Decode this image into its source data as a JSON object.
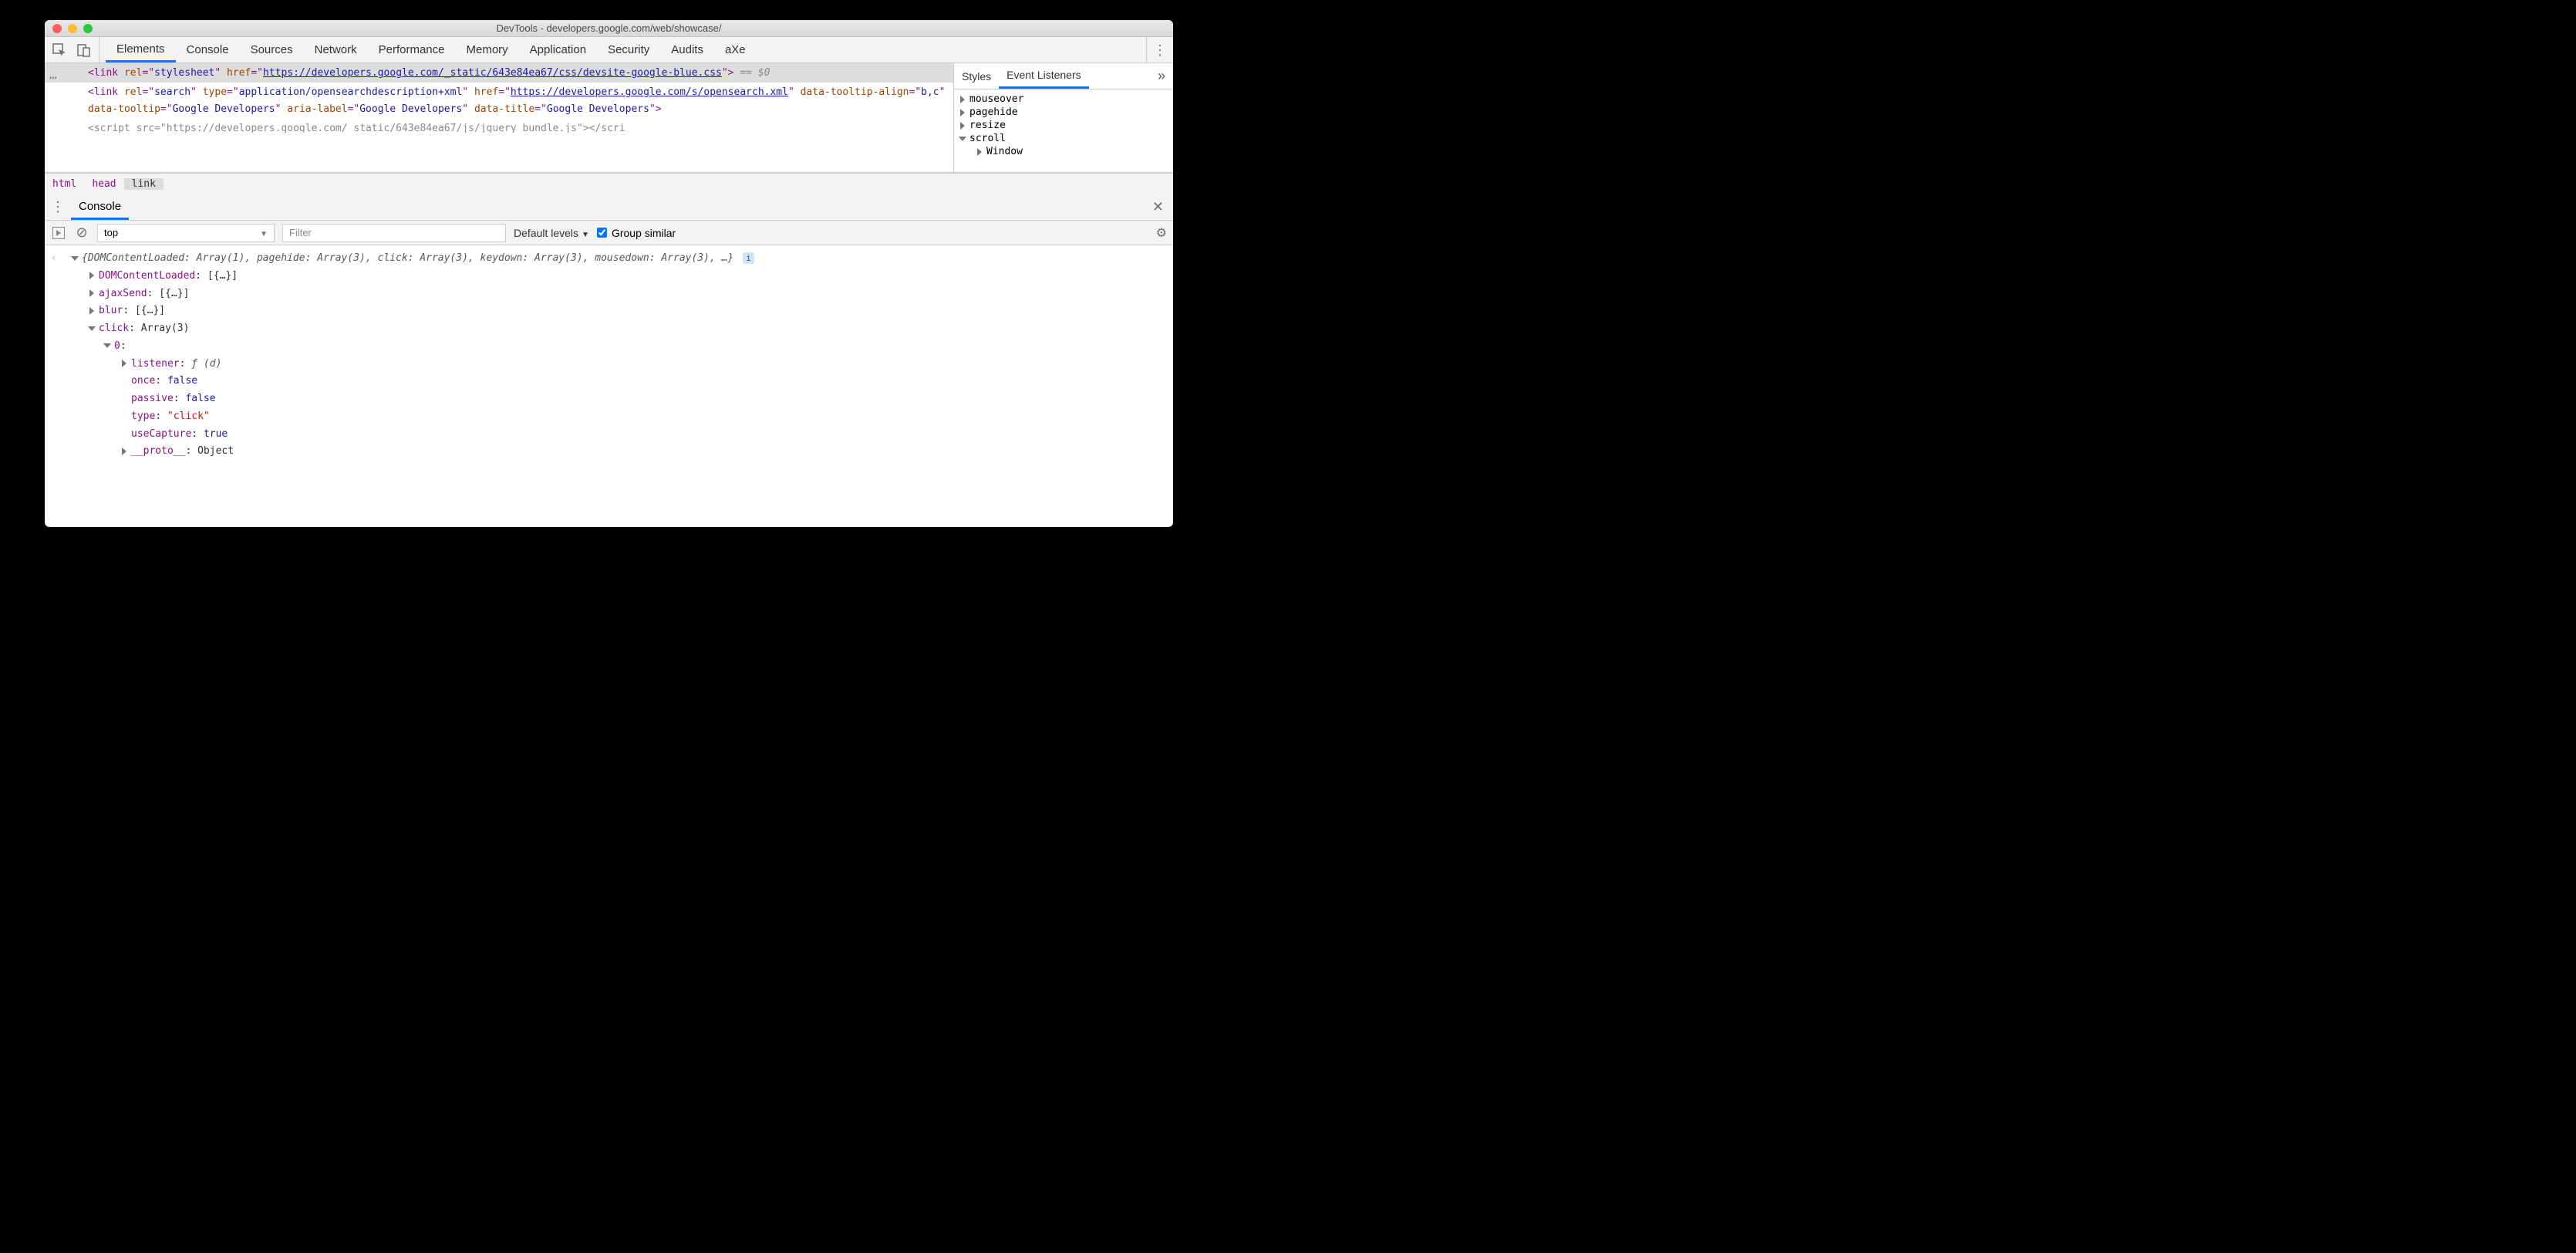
{
  "window": {
    "title": "DevTools - developers.google.com/web/showcase/"
  },
  "tabs": [
    "Elements",
    "Console",
    "Sources",
    "Network",
    "Performance",
    "Memory",
    "Application",
    "Security",
    "Audits",
    "aXe"
  ],
  "activeTab": "Elements",
  "dom": {
    "row1": {
      "tag": "link",
      "rel": "stylesheet",
      "href": "https://developers.google.com/_static/643e84ea67/css/devsite-google-blue.css",
      "selected_marker": "== $0"
    },
    "row2": {
      "tag": "link",
      "rel": "search",
      "type": "application/opensearchdescription+xml",
      "href": "https://developers.google.com/s/opensearch.xml",
      "tooltip_align": "b,c",
      "tooltip": "Google Developers",
      "aria_label": "Google Developers",
      "data_title": "Google Developers"
    },
    "row3_partial": "<script src=\"https://developers.google.com/_static/643e84ea67/js/jquery_bundle.js\"></scri"
  },
  "breadcrumb": [
    "html",
    "head",
    "link"
  ],
  "sidebar": {
    "tabs": [
      "Styles",
      "Event Listeners"
    ],
    "activeTab": "Event Listeners",
    "listeners": [
      {
        "name": "mouseover",
        "open": false
      },
      {
        "name": "pagehide",
        "open": false
      },
      {
        "name": "resize",
        "open": false
      },
      {
        "name": "scroll",
        "open": true,
        "children": [
          "Window"
        ]
      }
    ]
  },
  "consoleDrawer": {
    "tab": "Console",
    "context": "top",
    "filterPlaceholder": "Filter",
    "levels": "Default levels",
    "groupSimilar": "Group similar"
  },
  "consoleOutput": {
    "summary": "{DOMContentLoaded: Array(1), pagehide: Array(3), click: Array(3), keydown: Array(3), mousedown: Array(3), …}",
    "lines": [
      {
        "key": "DOMContentLoaded",
        "val": "[{…}]",
        "open": false,
        "lvl": 1
      },
      {
        "key": "ajaxSend",
        "val": "[{…}]",
        "open": false,
        "lvl": 1
      },
      {
        "key": "blur",
        "val": "[{…}]",
        "open": false,
        "lvl": 1
      },
      {
        "key": "click",
        "val": "Array(3)",
        "open": true,
        "lvl": 1
      },
      {
        "key": "0",
        "val": "",
        "open": true,
        "lvl": 2
      },
      {
        "key": "listener",
        "val": "ƒ (d)",
        "open": false,
        "lvl": 3,
        "fn": true
      },
      {
        "key": "once",
        "val": "false",
        "lvl": 3,
        "bool": true
      },
      {
        "key": "passive",
        "val": "false",
        "lvl": 3,
        "bool": true
      },
      {
        "key": "type",
        "val": "\"click\"",
        "lvl": 3,
        "str": true
      },
      {
        "key": "useCapture",
        "val": "true",
        "lvl": 3,
        "bool": true
      },
      {
        "key": "__proto__",
        "val": "Object",
        "open": false,
        "lvl": 3,
        "proto": true
      }
    ]
  }
}
